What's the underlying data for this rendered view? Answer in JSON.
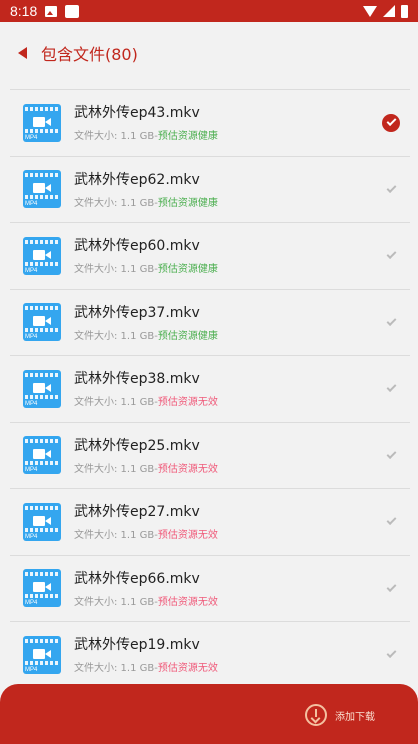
{
  "status_bar": {
    "time": "8:18"
  },
  "header": {
    "title": "包含文件(80)"
  },
  "files": [
    {
      "name": "武林外传ep43.mkv",
      "size_label": "文件大小: 1.1 GB-",
      "health": "预估资源健康",
      "healthy": true,
      "selected": true
    },
    {
      "name": "武林外传ep62.mkv",
      "size_label": "文件大小: 1.1 GB-",
      "health": "预估资源健康",
      "healthy": true,
      "selected": false
    },
    {
      "name": "武林外传ep60.mkv",
      "size_label": "文件大小: 1.1 GB-",
      "health": "预估资源健康",
      "healthy": true,
      "selected": false
    },
    {
      "name": "武林外传ep37.mkv",
      "size_label": "文件大小: 1.1 GB-",
      "health": "预估资源健康",
      "healthy": true,
      "selected": false
    },
    {
      "name": "武林外传ep38.mkv",
      "size_label": "文件大小: 1.1 GB-",
      "health": "预估资源无效",
      "healthy": false,
      "selected": false
    },
    {
      "name": "武林外传ep25.mkv",
      "size_label": "文件大小: 1.1 GB-",
      "health": "预估资源无效",
      "healthy": false,
      "selected": false
    },
    {
      "name": "武林外传ep27.mkv",
      "size_label": "文件大小: 1.1 GB-",
      "health": "预估资源无效",
      "healthy": false,
      "selected": false
    },
    {
      "name": "武林外传ep66.mkv",
      "size_label": "文件大小: 1.1 GB-",
      "health": "预估资源无效",
      "healthy": false,
      "selected": false
    },
    {
      "name": "武林外传ep19.mkv",
      "size_label": "文件大小: 1.1 GB-",
      "health": "预估资源无效",
      "healthy": false,
      "selected": false
    }
  ],
  "file_icon_tag": "MP4",
  "bottom_bar": {
    "download_label": "添加下载"
  },
  "colors": {
    "accent": "#c1271d",
    "healthy": "#4caf50",
    "invalid": "#f05a7a",
    "icon_blue": "#34a6ef"
  }
}
